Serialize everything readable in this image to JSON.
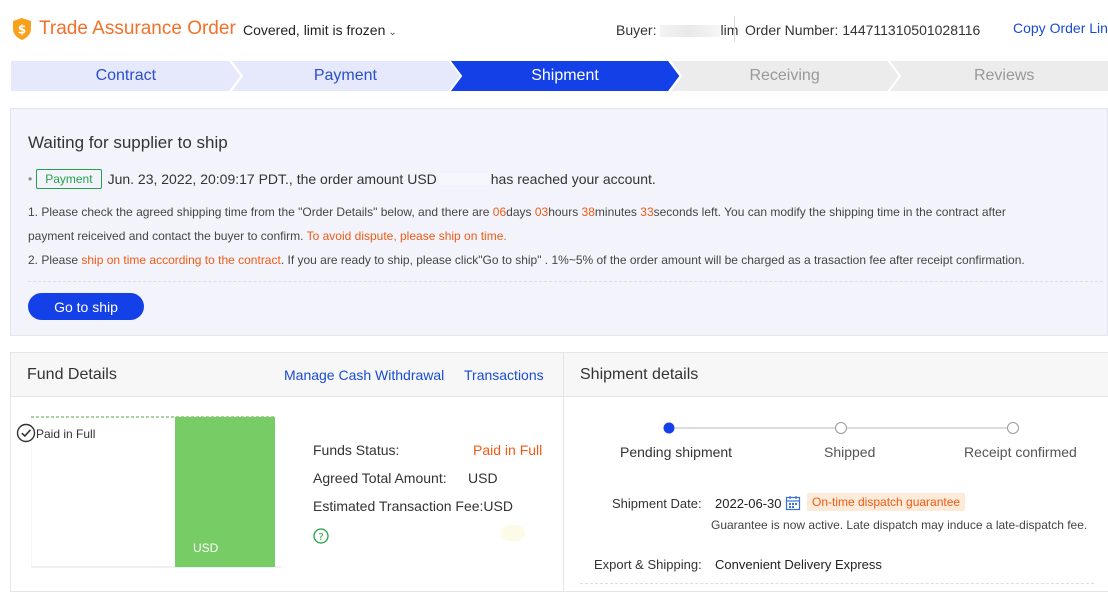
{
  "header": {
    "title": "Trade Assurance Order",
    "coverage": "Covered, limit is frozen",
    "buyer_label": "Buyer:",
    "buyer_suffix": "lim",
    "order_number": "Order Number: 144711310501028116",
    "copy_link": "Copy Order Lin",
    "brand_color": "#f37029",
    "icon": "shield-dollar-icon"
  },
  "steps": [
    {
      "label": "Contract",
      "state": "done"
    },
    {
      "label": "Payment",
      "state": "done"
    },
    {
      "label": "Shipment",
      "state": "current"
    },
    {
      "label": "Receiving",
      "state": "todo"
    },
    {
      "label": "Reviews",
      "state": "todo"
    }
  ],
  "colors": {
    "accent": "#1440e8",
    "done_bg": "#e6e9fb",
    "todo_bg": "#ececec",
    "highlight": "#f05a14",
    "success": "#24a148",
    "link": "#1a4bd6"
  },
  "status": {
    "title": "Waiting for supplier to ship",
    "badge": "Payment",
    "payment_before": "Jun. 23, 2022, 20:09:17 PDT., the order amount USD",
    "payment_after": "has reached your account.",
    "note1": {
      "a": "1. Please check the agreed shipping time from the \"Order Details\" below, and there are ",
      "days": "06",
      "days_unit": "days ",
      "hours": "03",
      "hours_unit": "hours ",
      "minutes": "38",
      "minutes_unit": "minutes ",
      "seconds": "33",
      "seconds_unit": "seconds left. You can modify the shipping time in the contract after",
      "b": "payment reiceived and contact the buyer to confirm. ",
      "warn": "To avoid dispute, please ship on time."
    },
    "note2": {
      "a": "2. Please ",
      "hl": "ship on time according to the contract",
      "b": ". If you are ready to ship, please click\"Go to ship\" . 1%~5% of the order amount will be charged as a trasaction fee after receipt confirmation."
    },
    "button": "Go to ship"
  },
  "fund": {
    "title": "Fund Details",
    "manage_link": "Manage Cash Withdrawal",
    "transactions_link": "Transactions",
    "chart_label": "Paid in Full",
    "bar_label": "USD",
    "bar_color": "#77cc66",
    "paid_fraction": 1.0,
    "status_label": "Funds Status:",
    "status_value": "Paid in Full",
    "total_label": "Agreed Total Amount:",
    "total_value": "USD",
    "fee_label": "Estimated Transaction Fee:USD"
  },
  "shipment": {
    "title": "Shipment details",
    "progress": [
      "Pending shipment",
      "Shipped",
      "Receipt confirmed"
    ],
    "current_index": 0,
    "date_label": "Shipment Date:",
    "date_value": "2022-06-30",
    "guarantee": "On-time dispatch guarantee",
    "guarantee_note": "Guarantee is now active. Late dispatch may induce a late-dispatch fee.",
    "export_label": "Export & Shipping:",
    "export_value": "Convenient Delivery Express"
  }
}
